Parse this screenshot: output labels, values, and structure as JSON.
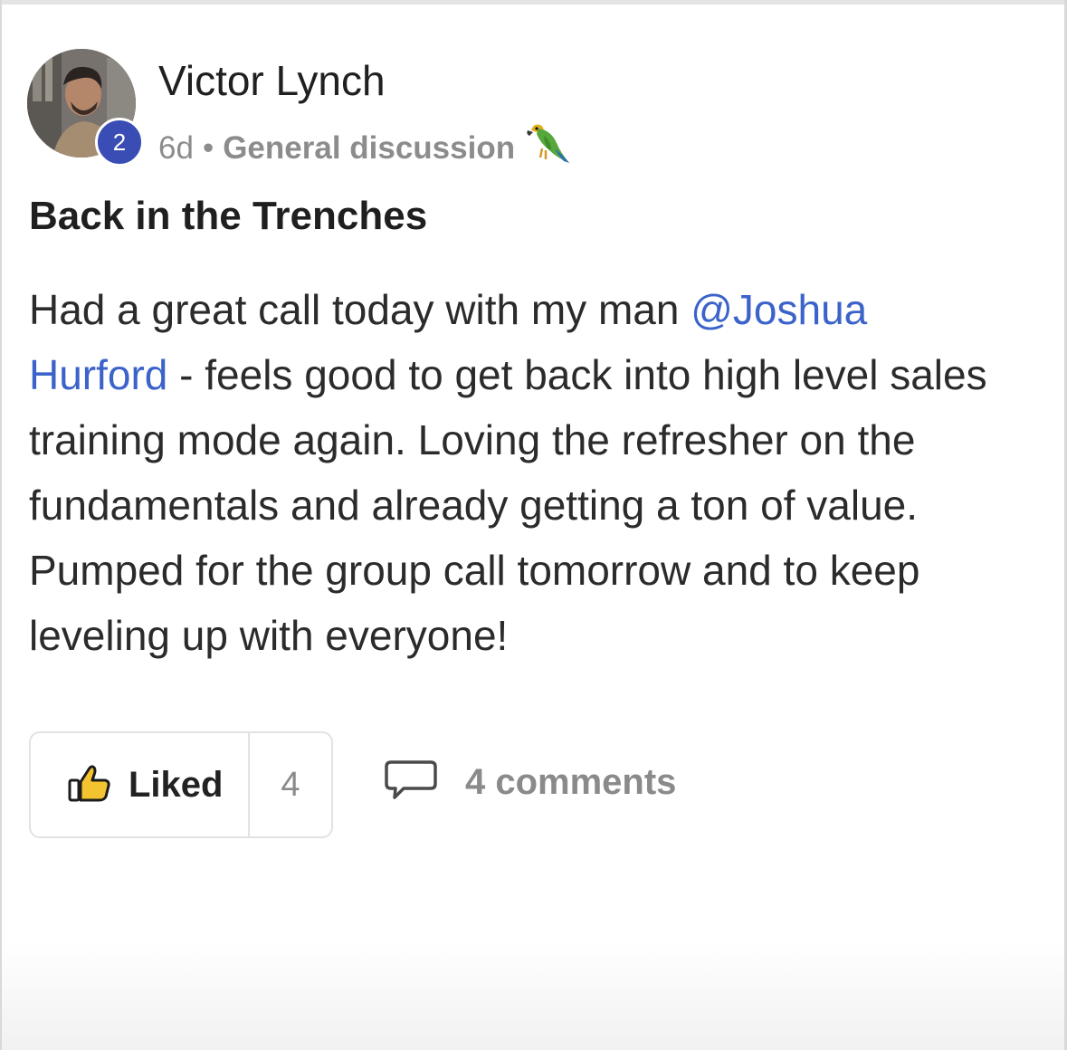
{
  "post": {
    "author": {
      "name": "Victor Lynch",
      "level": "2"
    },
    "meta": {
      "age": "6d",
      "separator": "•",
      "category": "General discussion",
      "category_emoji": "parrot-icon"
    },
    "title": "Back in the Trenches",
    "body": {
      "line1_text": "Had a great call today with my man ",
      "mention_part1": "@Joshua",
      "mention_part2": "Hurford",
      "line2_text": " - feels good to get back into high level sales",
      "line3": "training mode again. Loving the refresher on the",
      "line4": "fundamentals and already getting a ton of value.",
      "line5": "Pumped for the group call tomorrow and to keep",
      "line6": "leveling up with everyone!"
    },
    "actions": {
      "like_label": "Liked",
      "like_count": "4",
      "comments_label": "4 comments"
    }
  },
  "colors": {
    "mention": "#3b63c9",
    "badge": "#3a4db4",
    "muted": "#8c8c8c"
  }
}
